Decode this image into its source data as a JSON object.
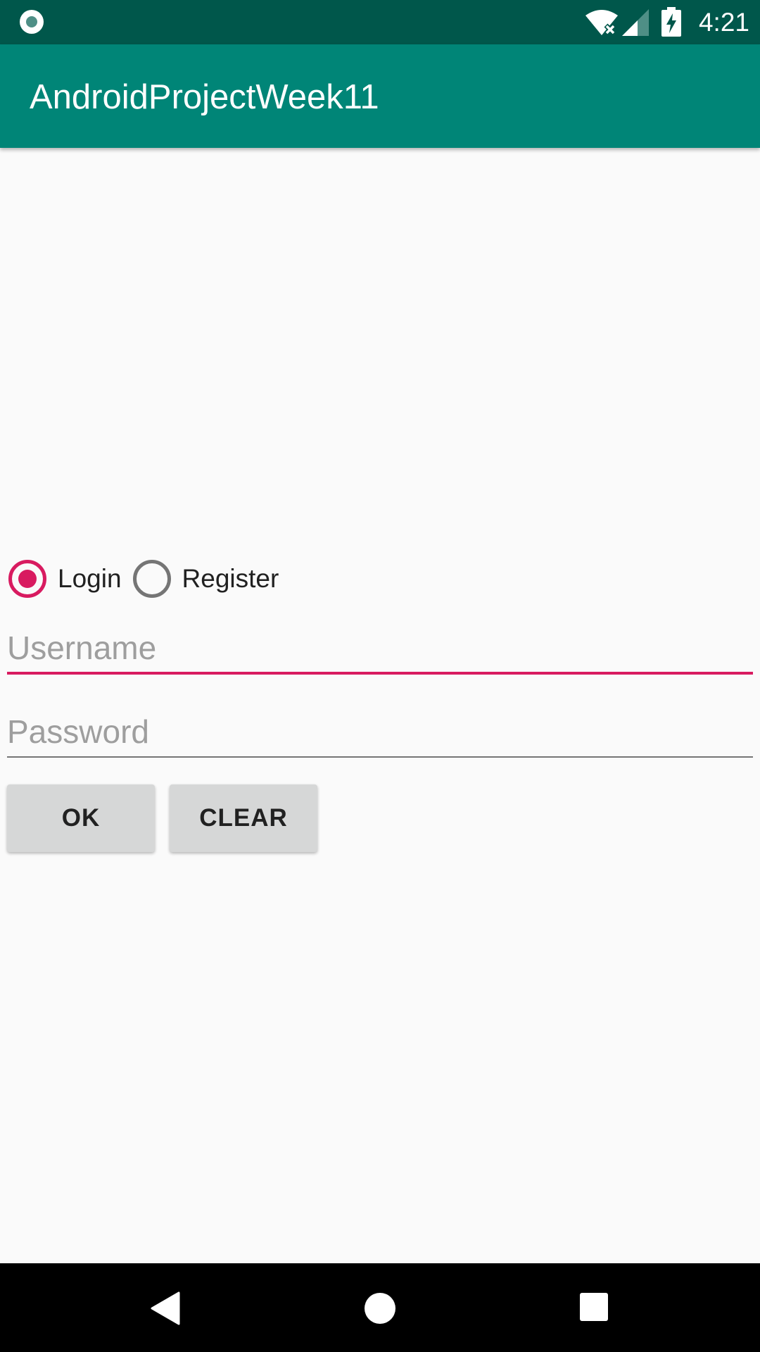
{
  "status_bar": {
    "time": "4:21",
    "icons": [
      "notification-dot-icon",
      "wifi-icon",
      "cell-signal-icon",
      "battery-charging-icon"
    ]
  },
  "app_bar": {
    "title": "AndroidProjectWeek11"
  },
  "radio_group": {
    "options": [
      {
        "label": "Login",
        "checked": true
      },
      {
        "label": "Register",
        "checked": false
      }
    ]
  },
  "form": {
    "username": {
      "value": "",
      "placeholder": "Username",
      "focused": true
    },
    "password": {
      "value": "",
      "placeholder": "Password",
      "focused": false
    }
  },
  "buttons": {
    "ok_label": "OK",
    "clear_label": "CLEAR"
  },
  "nav_bar": {
    "icons": [
      "back-icon",
      "home-icon",
      "recents-icon"
    ]
  },
  "colors": {
    "status_bar": "#00574b",
    "primary": "#008577",
    "accent": "#d81b60",
    "background": "#fafafa",
    "button": "#d6d7d7"
  }
}
